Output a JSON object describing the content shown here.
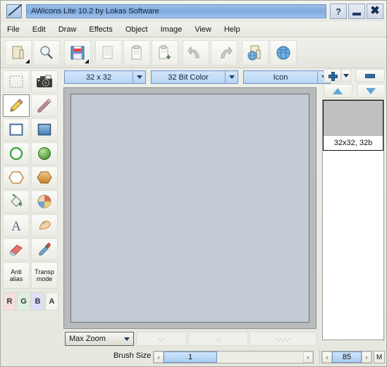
{
  "window": {
    "title": "AWicons Lite 10.2 by Lokas Software",
    "icon": "app-pencil-icon",
    "buttons": [
      {
        "name": "help-button",
        "label": "?"
      },
      {
        "name": "minimize-button",
        "label": ""
      },
      {
        "name": "close-button",
        "label": "✖"
      }
    ]
  },
  "menu": {
    "items": [
      {
        "label": "File"
      },
      {
        "label": "Edit"
      },
      {
        "label": "Draw"
      },
      {
        "label": "Effects"
      },
      {
        "label": "Object"
      },
      {
        "label": "Image"
      },
      {
        "label": "View"
      },
      {
        "label": "Help"
      }
    ]
  },
  "toolbar": {
    "buttons": [
      {
        "name": "new-image-button",
        "icon": "new-document-icon",
        "dropdown": true
      },
      {
        "name": "open-image-button",
        "icon": "magnifier-icon",
        "dropdown": false
      },
      {
        "name": "save-button",
        "icon": "floppy-disk-icon",
        "dropdown": true
      },
      {
        "name": "copy-page-button",
        "icon": "document-stack-icon",
        "dropdown": false
      },
      {
        "name": "paste-button",
        "icon": "clipboard-icon",
        "dropdown": false
      },
      {
        "name": "paste-new-button",
        "icon": "clipboard-plus-icon",
        "dropdown": false
      },
      {
        "name": "undo-button",
        "icon": "undo-arrow-icon",
        "dropdown": false
      },
      {
        "name": "redo-button",
        "icon": "redo-arrow-icon",
        "dropdown": false
      },
      {
        "name": "web-export-button",
        "icon": "globe-document-icon",
        "dropdown": false
      },
      {
        "name": "internet-button",
        "icon": "globe-icon",
        "dropdown": false
      }
    ]
  },
  "tools": {
    "items": [
      {
        "name": "tool-select-rect",
        "icon": "marquee-select-icon",
        "selected": false
      },
      {
        "name": "tool-screen-capture",
        "icon": "camera-icon",
        "selected": false
      },
      {
        "name": "tool-pencil",
        "icon": "pencil-icon",
        "selected": true
      },
      {
        "name": "tool-line",
        "icon": "line-pencil-icon",
        "selected": false
      },
      {
        "name": "tool-rectangle",
        "icon": "rectangle-outline-icon",
        "selected": false
      },
      {
        "name": "tool-filled-rectangle",
        "icon": "rectangle-filled-icon",
        "selected": false
      },
      {
        "name": "tool-ellipse",
        "icon": "ellipse-outline-icon",
        "selected": false
      },
      {
        "name": "tool-filled-ellipse",
        "icon": "ellipse-filled-icon",
        "selected": false
      },
      {
        "name": "tool-polygon",
        "icon": "polygon-outline-icon",
        "selected": false
      },
      {
        "name": "tool-filled-polygon",
        "icon": "polygon-filled-icon",
        "selected": false
      },
      {
        "name": "tool-paint-bucket",
        "icon": "paint-bucket-icon",
        "selected": false
      },
      {
        "name": "tool-gradient-fill",
        "icon": "gradient-fill-icon",
        "selected": false
      },
      {
        "name": "tool-text",
        "icon": "text-a-icon",
        "selected": false
      },
      {
        "name": "tool-smudge",
        "icon": "smudge-finger-icon",
        "selected": false
      },
      {
        "name": "tool-eraser",
        "icon": "eraser-icon",
        "selected": false
      },
      {
        "name": "tool-color-picker",
        "icon": "eyedropper-icon",
        "selected": false
      }
    ],
    "toggles": [
      {
        "name": "anti-alias-toggle",
        "line1": "Anti",
        "line2": "alias"
      },
      {
        "name": "transparency-mode-toggle",
        "line1": "Transp",
        "line2": "mode"
      }
    ],
    "channels": [
      {
        "name": "channel-r",
        "label": "R",
        "color": "#f6dede"
      },
      {
        "name": "channel-g",
        "label": "G",
        "color": "#ddf0dd"
      },
      {
        "name": "channel-b",
        "label": "B",
        "color": "#dde0f6"
      },
      {
        "name": "channel-a",
        "label": "A",
        "color": "#f4f4f0"
      }
    ]
  },
  "options": {
    "size": {
      "label": "32 x 32",
      "name": "image-size-select"
    },
    "color_depth": {
      "label": "32 Bit Color",
      "name": "color-depth-select"
    },
    "image_type": {
      "label": "Icon",
      "name": "image-type-select"
    }
  },
  "image_nav": {
    "add_label": "",
    "delete_label": "",
    "move_up_label": "",
    "move_down_label": ""
  },
  "image_list": {
    "items": [
      {
        "name": "image-list-item",
        "caption": "32x32, 32b"
      }
    ]
  },
  "status": {
    "zoom": {
      "label": "Max Zoom",
      "name": "zoom-select"
    },
    "field1": "-,-",
    "field2": "-,-",
    "field3": "-,-,-,-"
  },
  "bottom": {
    "brush_size_label": "Brush Size",
    "brush_size_value": "1",
    "opacity_value": "85",
    "mode_button_label": "M",
    "left_arrow": "‹",
    "right_arrow": "›"
  },
  "colors": {
    "title_bar": "#7fa9dd",
    "canvas_fill": "#c3ccd4",
    "canvas_frame": "#b9babb",
    "combo_fill": "#b8d5f3",
    "accent": "#2f6ca3"
  }
}
